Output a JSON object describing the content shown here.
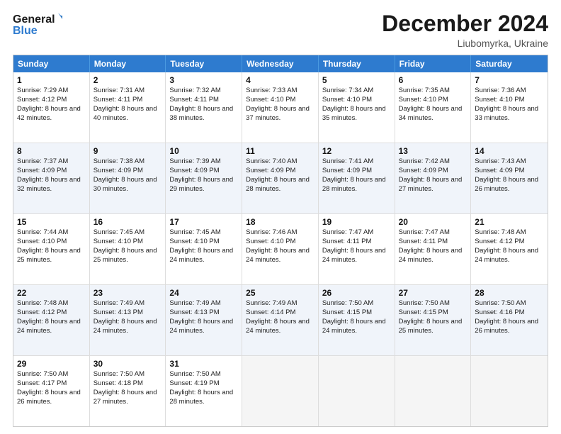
{
  "header": {
    "logo_line1": "General",
    "logo_line2": "Blue",
    "title": "December 2024",
    "subtitle": "Liubomyrka, Ukraine"
  },
  "days": [
    "Sunday",
    "Monday",
    "Tuesday",
    "Wednesday",
    "Thursday",
    "Friday",
    "Saturday"
  ],
  "weeks": [
    [
      {
        "day": "1",
        "sunrise": "Sunrise: 7:29 AM",
        "sunset": "Sunset: 4:12 PM",
        "daylight": "Daylight: 8 hours and 42 minutes."
      },
      {
        "day": "2",
        "sunrise": "Sunrise: 7:31 AM",
        "sunset": "Sunset: 4:11 PM",
        "daylight": "Daylight: 8 hours and 40 minutes."
      },
      {
        "day": "3",
        "sunrise": "Sunrise: 7:32 AM",
        "sunset": "Sunset: 4:11 PM",
        "daylight": "Daylight: 8 hours and 38 minutes."
      },
      {
        "day": "4",
        "sunrise": "Sunrise: 7:33 AM",
        "sunset": "Sunset: 4:10 PM",
        "daylight": "Daylight: 8 hours and 37 minutes."
      },
      {
        "day": "5",
        "sunrise": "Sunrise: 7:34 AM",
        "sunset": "Sunset: 4:10 PM",
        "daylight": "Daylight: 8 hours and 35 minutes."
      },
      {
        "day": "6",
        "sunrise": "Sunrise: 7:35 AM",
        "sunset": "Sunset: 4:10 PM",
        "daylight": "Daylight: 8 hours and 34 minutes."
      },
      {
        "day": "7",
        "sunrise": "Sunrise: 7:36 AM",
        "sunset": "Sunset: 4:10 PM",
        "daylight": "Daylight: 8 hours and 33 minutes."
      }
    ],
    [
      {
        "day": "8",
        "sunrise": "Sunrise: 7:37 AM",
        "sunset": "Sunset: 4:09 PM",
        "daylight": "Daylight: 8 hours and 32 minutes."
      },
      {
        "day": "9",
        "sunrise": "Sunrise: 7:38 AM",
        "sunset": "Sunset: 4:09 PM",
        "daylight": "Daylight: 8 hours and 30 minutes."
      },
      {
        "day": "10",
        "sunrise": "Sunrise: 7:39 AM",
        "sunset": "Sunset: 4:09 PM",
        "daylight": "Daylight: 8 hours and 29 minutes."
      },
      {
        "day": "11",
        "sunrise": "Sunrise: 7:40 AM",
        "sunset": "Sunset: 4:09 PM",
        "daylight": "Daylight: 8 hours and 28 minutes."
      },
      {
        "day": "12",
        "sunrise": "Sunrise: 7:41 AM",
        "sunset": "Sunset: 4:09 PM",
        "daylight": "Daylight: 8 hours and 28 minutes."
      },
      {
        "day": "13",
        "sunrise": "Sunrise: 7:42 AM",
        "sunset": "Sunset: 4:09 PM",
        "daylight": "Daylight: 8 hours and 27 minutes."
      },
      {
        "day": "14",
        "sunrise": "Sunrise: 7:43 AM",
        "sunset": "Sunset: 4:09 PM",
        "daylight": "Daylight: 8 hours and 26 minutes."
      }
    ],
    [
      {
        "day": "15",
        "sunrise": "Sunrise: 7:44 AM",
        "sunset": "Sunset: 4:10 PM",
        "daylight": "Daylight: 8 hours and 25 minutes."
      },
      {
        "day": "16",
        "sunrise": "Sunrise: 7:45 AM",
        "sunset": "Sunset: 4:10 PM",
        "daylight": "Daylight: 8 hours and 25 minutes."
      },
      {
        "day": "17",
        "sunrise": "Sunrise: 7:45 AM",
        "sunset": "Sunset: 4:10 PM",
        "daylight": "Daylight: 8 hours and 24 minutes."
      },
      {
        "day": "18",
        "sunrise": "Sunrise: 7:46 AM",
        "sunset": "Sunset: 4:10 PM",
        "daylight": "Daylight: 8 hours and 24 minutes."
      },
      {
        "day": "19",
        "sunrise": "Sunrise: 7:47 AM",
        "sunset": "Sunset: 4:11 PM",
        "daylight": "Daylight: 8 hours and 24 minutes."
      },
      {
        "day": "20",
        "sunrise": "Sunrise: 7:47 AM",
        "sunset": "Sunset: 4:11 PM",
        "daylight": "Daylight: 8 hours and 24 minutes."
      },
      {
        "day": "21",
        "sunrise": "Sunrise: 7:48 AM",
        "sunset": "Sunset: 4:12 PM",
        "daylight": "Daylight: 8 hours and 24 minutes."
      }
    ],
    [
      {
        "day": "22",
        "sunrise": "Sunrise: 7:48 AM",
        "sunset": "Sunset: 4:12 PM",
        "daylight": "Daylight: 8 hours and 24 minutes."
      },
      {
        "day": "23",
        "sunrise": "Sunrise: 7:49 AM",
        "sunset": "Sunset: 4:13 PM",
        "daylight": "Daylight: 8 hours and 24 minutes."
      },
      {
        "day": "24",
        "sunrise": "Sunrise: 7:49 AM",
        "sunset": "Sunset: 4:13 PM",
        "daylight": "Daylight: 8 hours and 24 minutes."
      },
      {
        "day": "25",
        "sunrise": "Sunrise: 7:49 AM",
        "sunset": "Sunset: 4:14 PM",
        "daylight": "Daylight: 8 hours and 24 minutes."
      },
      {
        "day": "26",
        "sunrise": "Sunrise: 7:50 AM",
        "sunset": "Sunset: 4:15 PM",
        "daylight": "Daylight: 8 hours and 24 minutes."
      },
      {
        "day": "27",
        "sunrise": "Sunrise: 7:50 AM",
        "sunset": "Sunset: 4:15 PM",
        "daylight": "Daylight: 8 hours and 25 minutes."
      },
      {
        "day": "28",
        "sunrise": "Sunrise: 7:50 AM",
        "sunset": "Sunset: 4:16 PM",
        "daylight": "Daylight: 8 hours and 26 minutes."
      }
    ],
    [
      {
        "day": "29",
        "sunrise": "Sunrise: 7:50 AM",
        "sunset": "Sunset: 4:17 PM",
        "daylight": "Daylight: 8 hours and 26 minutes."
      },
      {
        "day": "30",
        "sunrise": "Sunrise: 7:50 AM",
        "sunset": "Sunset: 4:18 PM",
        "daylight": "Daylight: 8 hours and 27 minutes."
      },
      {
        "day": "31",
        "sunrise": "Sunrise: 7:50 AM",
        "sunset": "Sunset: 4:19 PM",
        "daylight": "Daylight: 8 hours and 28 minutes."
      },
      null,
      null,
      null,
      null
    ]
  ],
  "alt_rows": [
    1,
    3
  ]
}
